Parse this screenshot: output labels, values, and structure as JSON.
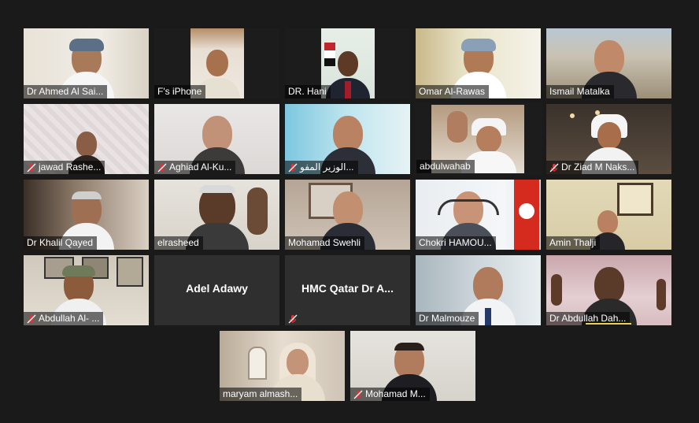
{
  "participants": [
    {
      "name": "Dr Ahmed Al Sai...",
      "muted": false
    },
    {
      "name": "F's iPhone",
      "muted": false
    },
    {
      "name": "DR. Hani",
      "muted": false
    },
    {
      "name": "Omar Al-Rawas",
      "muted": false
    },
    {
      "name": "Ismail Matalka",
      "muted": false
    },
    {
      "name": "jawad Rashe...",
      "muted": true
    },
    {
      "name": "Aghiad Al-Ku...",
      "muted": true
    },
    {
      "name": "الوزير المفو...",
      "muted": true
    },
    {
      "name": "abdulwahab",
      "muted": false,
      "active_speaker": true
    },
    {
      "name": "Dr Ziad M Naks...",
      "muted": true
    },
    {
      "name": "Dr Khalil Qayed",
      "muted": false
    },
    {
      "name": "elrasheed",
      "muted": false
    },
    {
      "name": "Mohamad Swehli",
      "muted": false
    },
    {
      "name": "Chokri HAMOU...",
      "muted": false
    },
    {
      "name": "Amin Thalji",
      "muted": false
    },
    {
      "name": "Abdullah Al- ...",
      "muted": true
    },
    {
      "name": "Adel Adawy",
      "muted": false,
      "video_off": true
    },
    {
      "name": "HMC Qatar Dr A...",
      "muted": true,
      "video_off": true
    },
    {
      "name": "Dr Malmouze",
      "muted": false
    },
    {
      "name": "Dr Abdullah Dah...",
      "muted": false
    },
    {
      "name": "maryam almash...",
      "muted": false
    },
    {
      "name": "Mohamad M...",
      "muted": true
    }
  ],
  "colors": {
    "background": "#1a1a1a",
    "tile_empty": "#2f2f2f",
    "active_border": "#b7d43a",
    "mute_icon": "#e0323a",
    "name_text": "#ffffff"
  }
}
